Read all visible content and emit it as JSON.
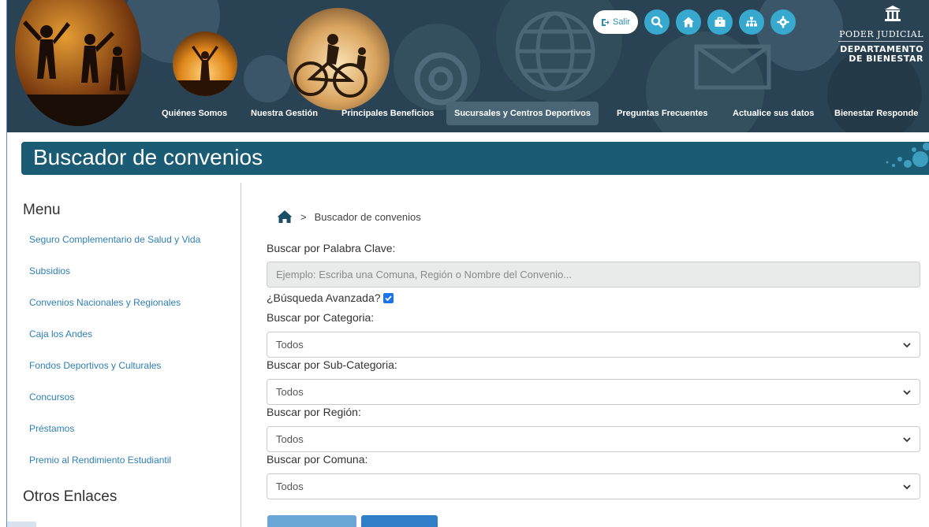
{
  "header": {
    "salir_label": "Salir",
    "icons": [
      "search-icon",
      "home-icon",
      "briefcase-icon",
      "sitemap-icon",
      "gear-icon"
    ],
    "logo_line1": "PODER JUDICIAL",
    "logo_line2": "DEPARTAMENTO",
    "logo_line3": "DE BIENESTAR",
    "nav": [
      {
        "label": "Quiénes Somos"
      },
      {
        "label": "Nuestra Gestión"
      },
      {
        "label": "Principales Beneficios"
      },
      {
        "label": "Sucursales y Centros Deportivos"
      },
      {
        "label": "Preguntas Frecuentes"
      },
      {
        "label": "Actualice sus datos"
      },
      {
        "label": "Bienestar Responde"
      }
    ]
  },
  "page_title": "Buscador de convenios",
  "sidebar": {
    "menu_title": "Menu",
    "items": [
      {
        "label": "Seguro Complementario de Salud y Vida"
      },
      {
        "label": "Subsidios"
      },
      {
        "label": "Convenios Nacionales y Regionales"
      },
      {
        "label": "Caja los Andes"
      },
      {
        "label": "Fondos Deportivos y Culturales"
      },
      {
        "label": "Concursos"
      },
      {
        "label": "Préstamos"
      },
      {
        "label": "Premio al Rendimiento Estudiantil"
      }
    ],
    "other_title": "Otros Enlaces"
  },
  "breadcrumb": {
    "separator": ">",
    "current": "Buscador de convenios"
  },
  "form": {
    "keyword_label": "Buscar por Palabra Clave:",
    "keyword_placeholder": "Ejemplo: Escriba una Comuna, Región o Nombre del Convenio...",
    "advanced_label": "¿Búsqueda Avanzada?",
    "advanced_checked": true,
    "category_label": "Buscar por Categoria:",
    "category_value": "Todos",
    "subcategory_label": "Buscar por Sub-Categoria:",
    "subcategory_value": "Todos",
    "region_label": "Buscar por Región:",
    "region_value": "Todos",
    "comuna_label": "Buscar por Comuna:",
    "comuna_value": "Todos"
  },
  "colors": {
    "header_bg": "#2a4354",
    "title_bar": "#1b5b73",
    "link": "#2f7fb5",
    "accent_btn": "#37a9cf"
  }
}
